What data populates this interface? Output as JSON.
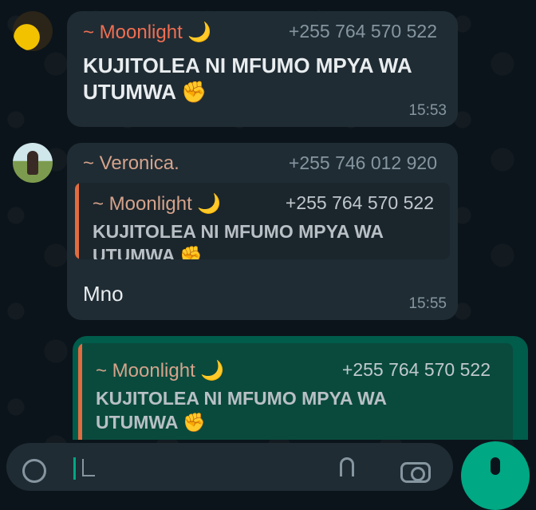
{
  "messages": [
    {
      "sender": "~ Moonlight 🌙",
      "phone": "+255 764 570 522",
      "text": "KUJITOLEA NI MFUMO MPYA WA UTUMWA ✊",
      "time": "15:53"
    },
    {
      "sender": "~ Veronica.",
      "phone": "+255 746 012 920",
      "quote": {
        "sender": "~ Moonlight 🌙",
        "phone": "+255 764 570 522",
        "text": "KUJITOLEA NI MFUMO MPYA WA UTUMWA ✊"
      },
      "text": "Mno",
      "time": "15:55"
    },
    {
      "quote": {
        "sender": "~ Moonlight 🌙",
        "phone": "+255 764 570 522",
        "text": "KUJITOLEA NI MFUMO MPYA WA UTUMWA ✊"
      }
    }
  ],
  "composer": {
    "icons": [
      "emoji-icon",
      "attach-icon",
      "camera-icon",
      "mic-icon"
    ]
  },
  "colors": {
    "background": "#0b141a",
    "incoming_bubble": "#1f2c34",
    "outgoing_bubble": "#005c4b",
    "accent": "#00a884",
    "sender_1": "#f06e52",
    "sender_2": "#d5a38b"
  }
}
